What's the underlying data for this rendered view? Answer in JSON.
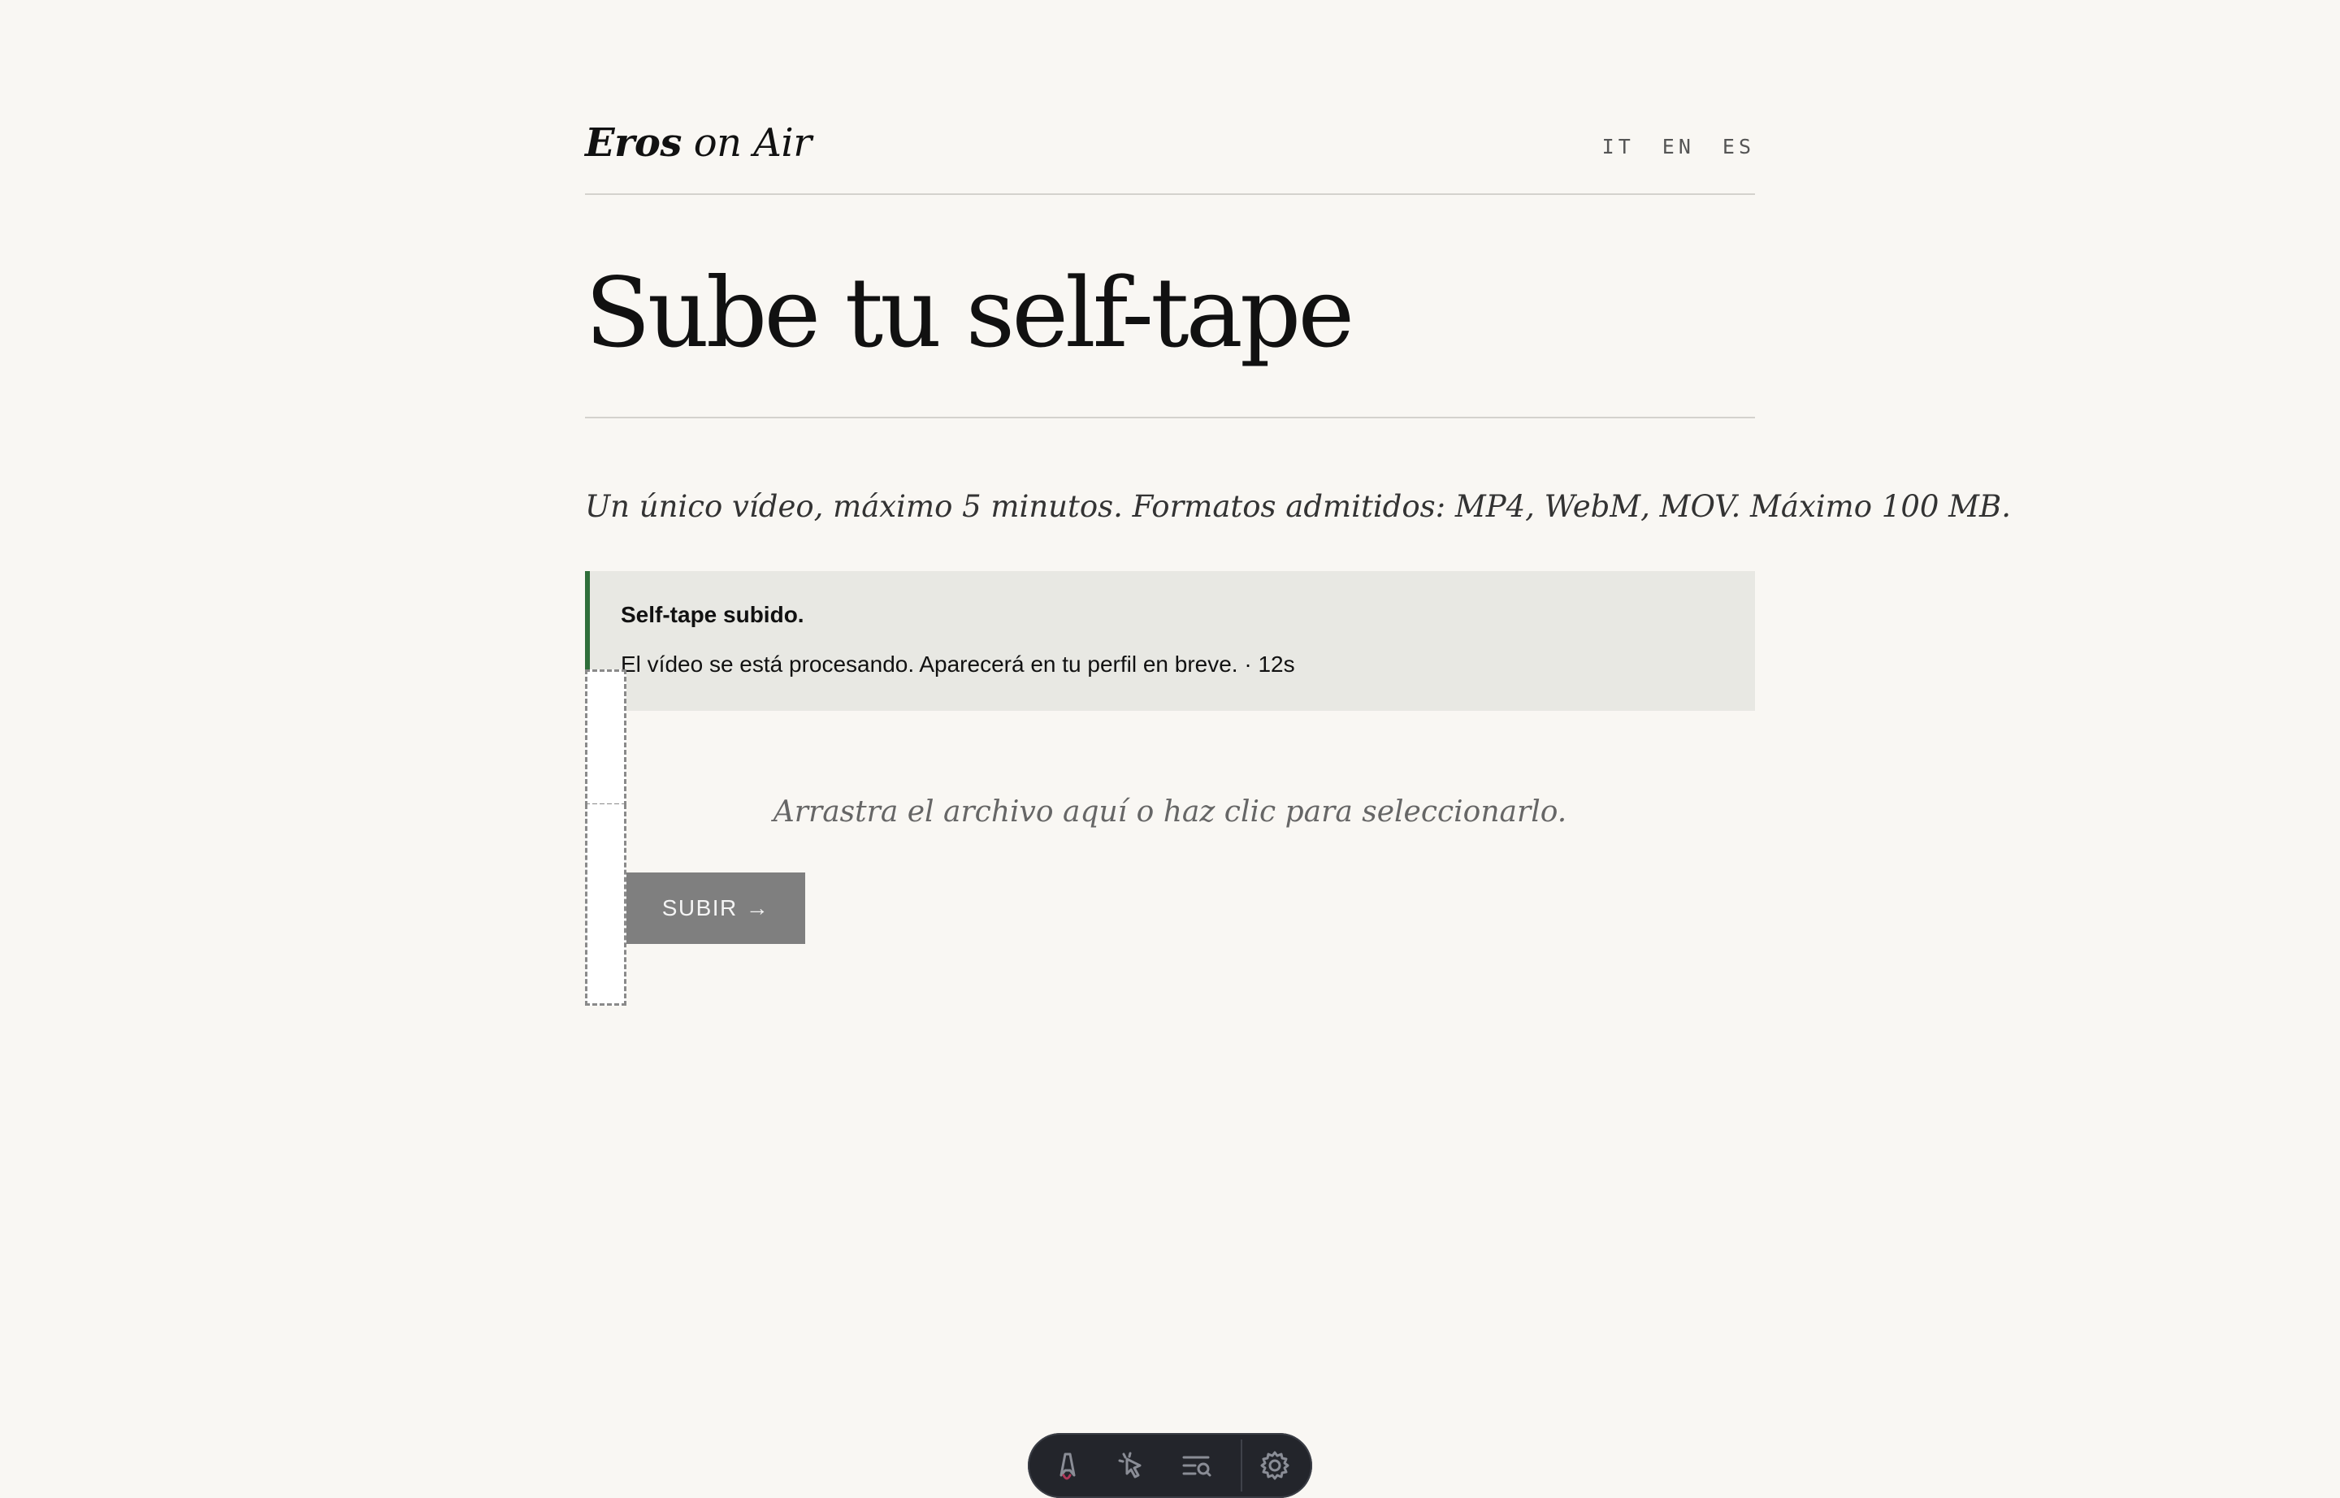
{
  "brand": {
    "bold": "Eros",
    "rest": "on Air"
  },
  "languages": [
    "IT",
    "EN",
    "ES"
  ],
  "page": {
    "title": "Sube tu self-tape",
    "lead": "Un único vídeo, máximo 5 minutos. Formatos admitidos: MP4, WebM, MOV. Máximo 100 MB."
  },
  "notice": {
    "heading": "Self-tape subido.",
    "body": "El vídeo se está procesando. Aparecerá en tu perfil en breve. · 12s",
    "accent_color": "#2f6e3a"
  },
  "dropzone": {
    "text": "Arrastra el archivo aquí o haz clic para seleccionarlo."
  },
  "submit": {
    "label": "SUBIR",
    "arrow": "→"
  },
  "devtoolbar": {
    "items": [
      "astro-logo-icon",
      "cursor-inspect-icon",
      "audit-list-icon",
      "settings-gear-icon"
    ]
  }
}
